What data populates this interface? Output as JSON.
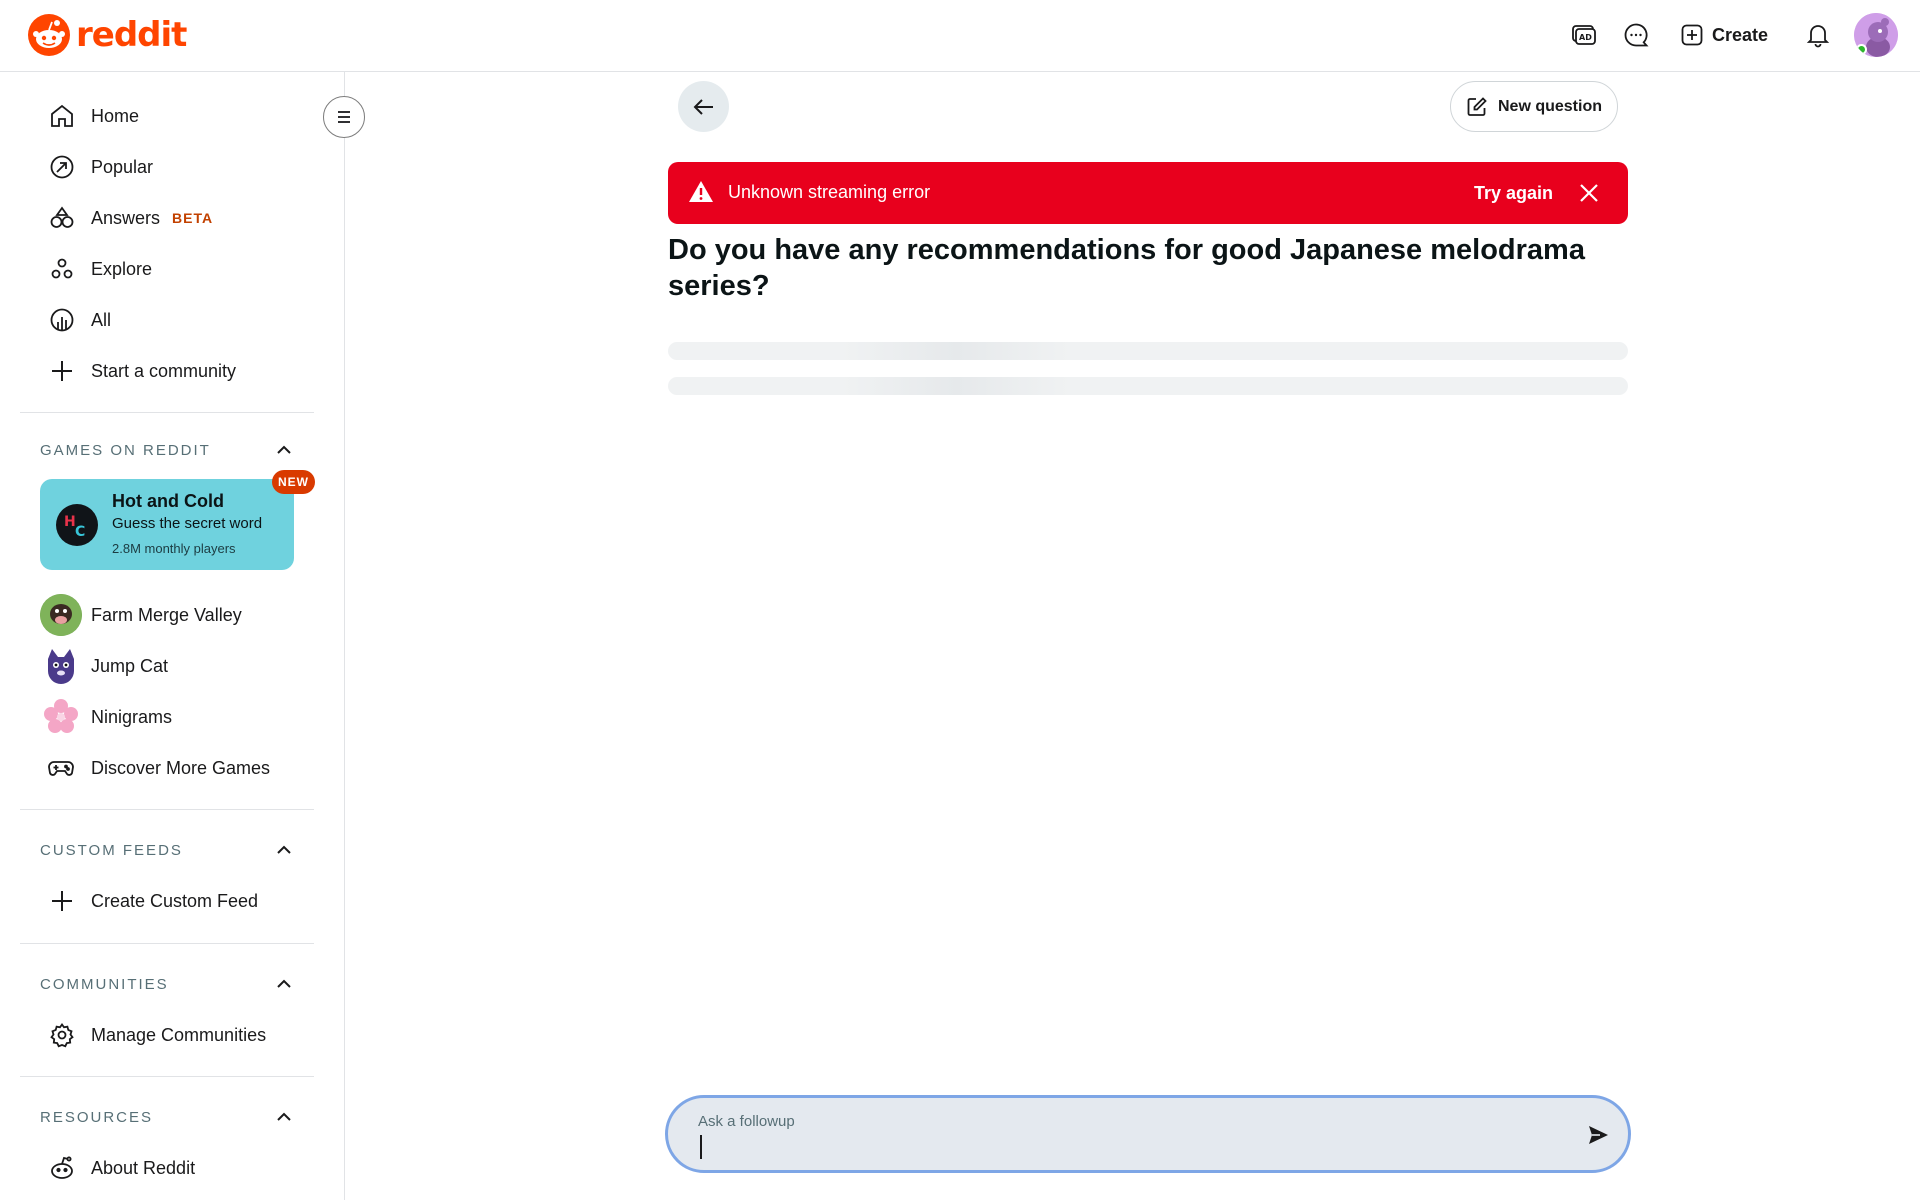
{
  "header": {
    "logo_text": "reddit",
    "create_label": "Create",
    "icons": [
      "ad-icon",
      "chat-icon",
      "create-plus-icon",
      "bell-icon",
      "avatar"
    ]
  },
  "sidebar": {
    "nav": [
      {
        "label": "Home",
        "icon": "home-icon"
      },
      {
        "label": "Popular",
        "icon": "popular-icon"
      },
      {
        "label": "Answers",
        "badge": "BETA",
        "icon": "answers-icon"
      },
      {
        "label": "Explore",
        "icon": "explore-icon"
      },
      {
        "label": "All",
        "icon": "all-icon"
      },
      {
        "label": "Start a community",
        "icon": "plus-icon"
      }
    ],
    "games_section": {
      "title": "GAMES ON REDDIT",
      "featured": {
        "title": "Hot and Cold",
        "subtitle": "Guess the secret word",
        "players": "2.8M monthly players",
        "badge": "NEW"
      },
      "games": [
        {
          "label": "Farm Merge Valley"
        },
        {
          "label": "Jump Cat"
        },
        {
          "label": "Ninigrams"
        },
        {
          "label": "Discover More Games"
        }
      ]
    },
    "custom_feeds": {
      "title": "CUSTOM FEEDS",
      "items": [
        {
          "label": "Create Custom Feed"
        }
      ]
    },
    "communities": {
      "title": "COMMUNITIES",
      "items": [
        {
          "label": "Manage Communities"
        }
      ]
    },
    "resources": {
      "title": "RESOURCES",
      "items": [
        {
          "label": "About Reddit"
        }
      ]
    }
  },
  "main": {
    "new_question_label": "New question",
    "error": {
      "message": "Unknown streaming error",
      "action": "Try again"
    },
    "question": "Do you have any recommendations for good Japanese melodrama series?",
    "followup_placeholder": "Ask a followup"
  },
  "colors": {
    "brand": "#ff4500",
    "error": "#e8001d",
    "game_card": "#6fd2de",
    "input_border": "#7ea6e6"
  }
}
